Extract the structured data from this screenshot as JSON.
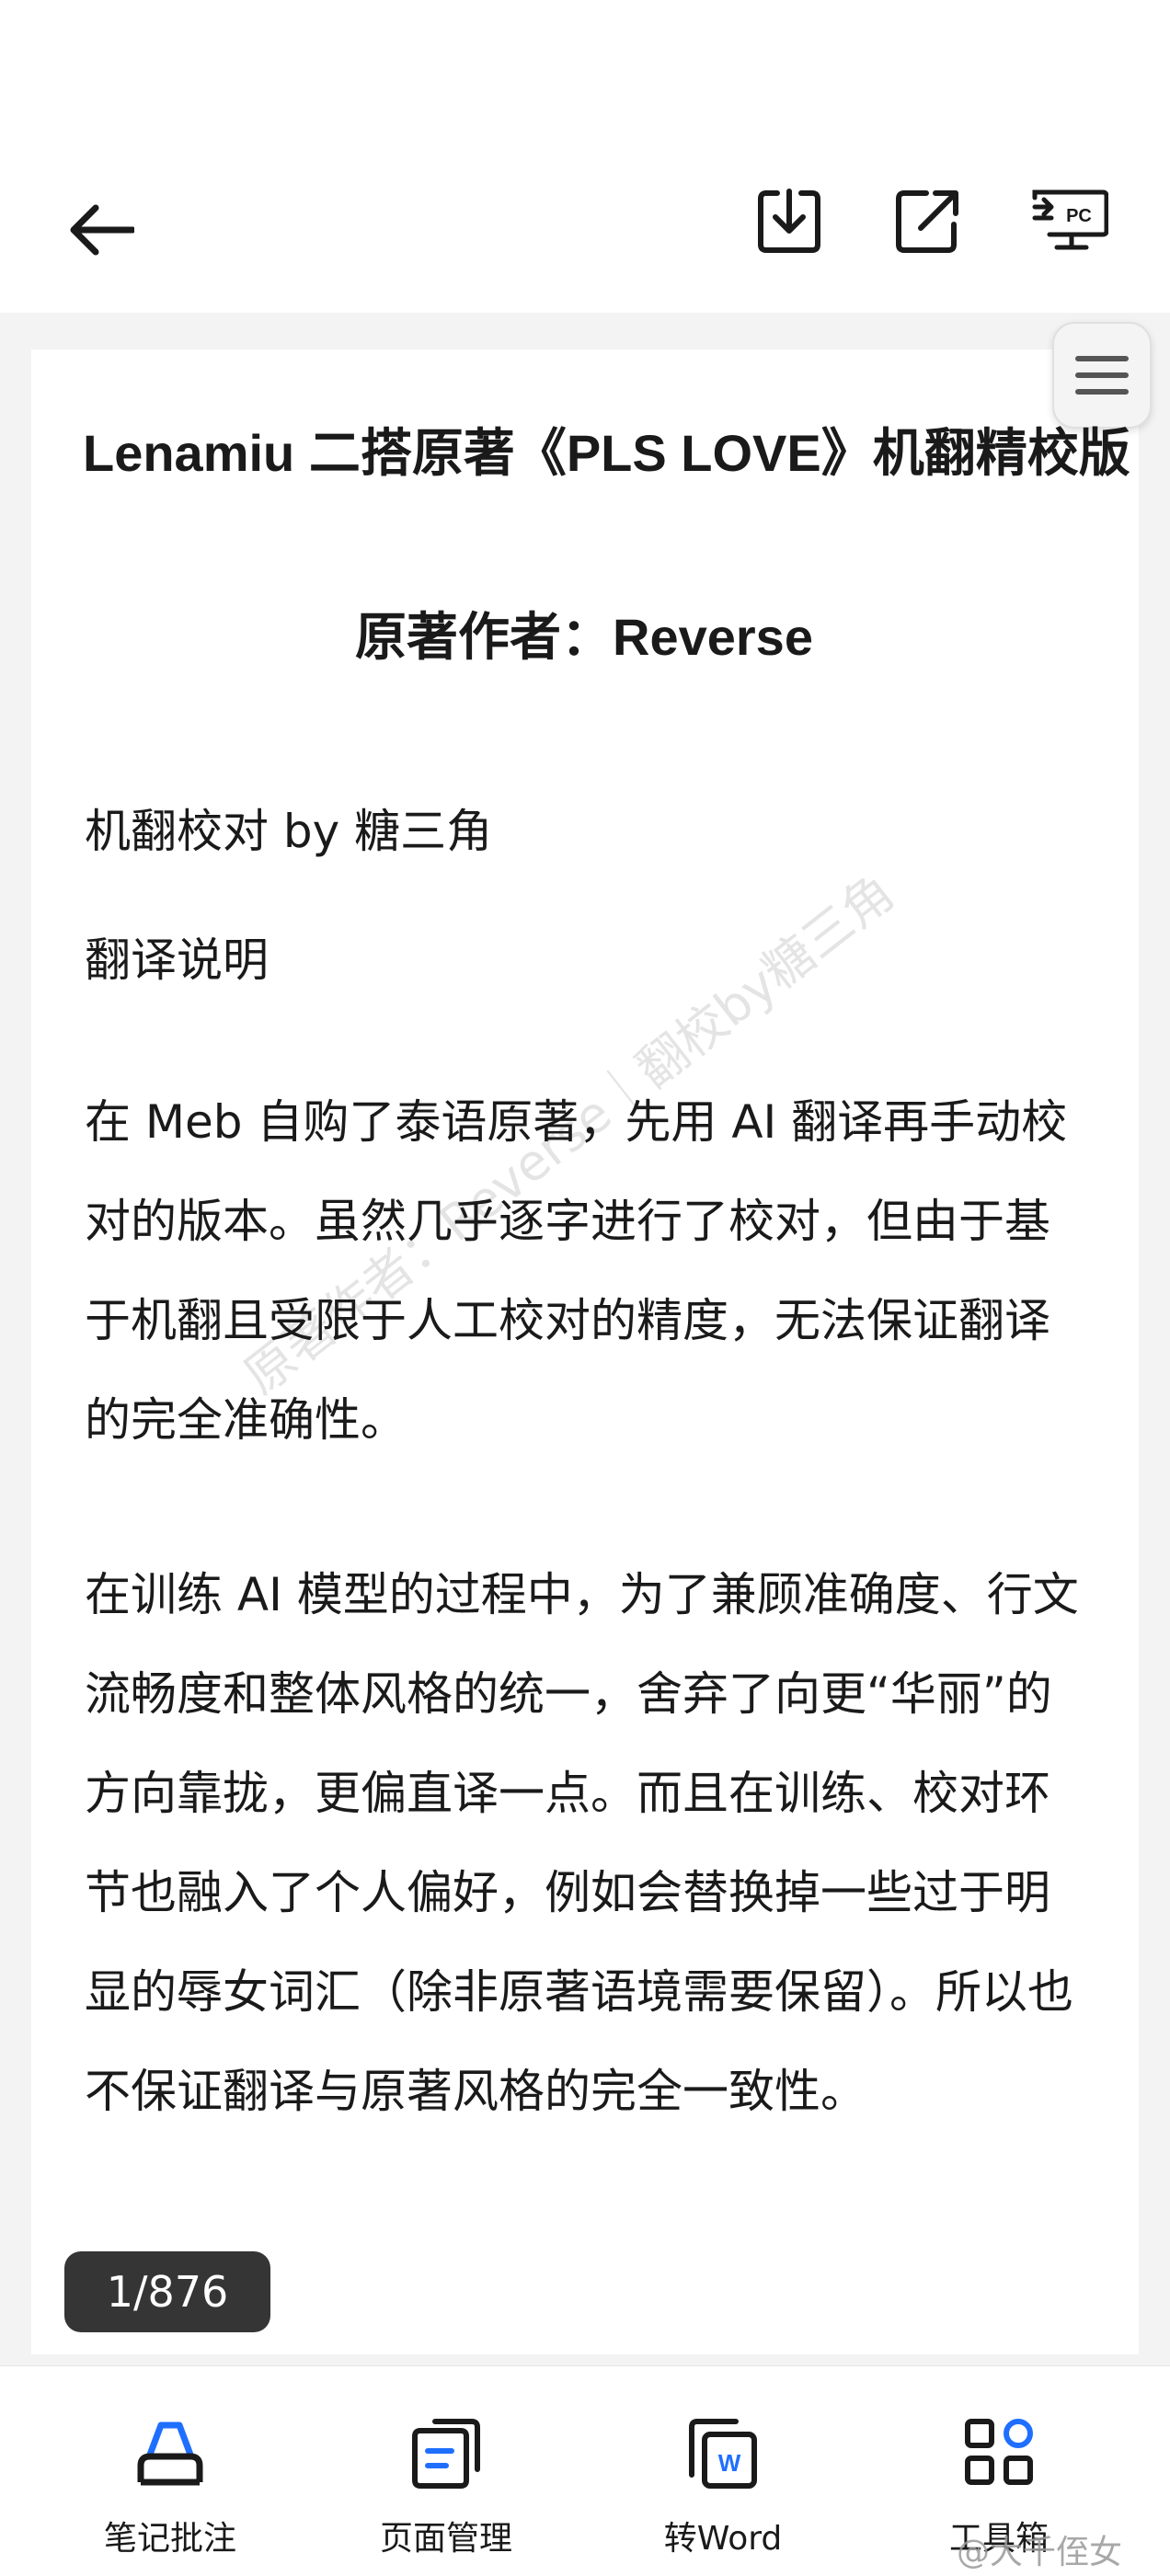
{
  "toolbar": {
    "back_icon": "arrow-left-icon",
    "download_icon": "download-icon",
    "share_icon": "share-icon",
    "pc_icon": "pc-icon",
    "pc_text": "PC"
  },
  "document": {
    "title": "Lenamiu 二搭原著《PLS LOVE》机翻精校版",
    "author": "原著作者：Reverse",
    "proofread": "机翻校对 by 糖三角",
    "section_heading": "翻译说明",
    "paragraphs": [
      "在 Meb 自购了泰语原著，先用 AI 翻译再手动校对的版本。虽然几乎逐字进行了校对，但由于基于机翻且受限于人工校对的精度，无法保证翻译的完全准确性。",
      "在训练 AI 模型的过程中，为了兼顾准确度、行文流畅度和整体风格的统一，舍弃了向更“华丽”的方向靠拢，更偏直译一点。而且在训练、校对环节也融入了个人偏好，例如会替换掉一些过于明显的辱女词汇（除非原著语境需要保留）。所以也不保证翻译与原著风格的完全一致性。"
    ],
    "watermark": "原著作者：Reverse｜翻校by糖三角"
  },
  "pager": {
    "current": "1/876"
  },
  "bottom_nav": [
    {
      "label": "笔记批注",
      "icon": "annotate-icon"
    },
    {
      "label": "页面管理",
      "icon": "page-manage-icon"
    },
    {
      "label": "转Word",
      "icon": "word-convert-icon",
      "icon_text": "W"
    },
    {
      "label": "工具箱",
      "icon": "toolbox-icon"
    }
  ],
  "overlay": {
    "weibo_watermark": "@大千侄女"
  },
  "colors": {
    "accent_blue": "#1f6fff",
    "icon_dark": "#1a1a1a",
    "counter_bg": "#353535"
  }
}
